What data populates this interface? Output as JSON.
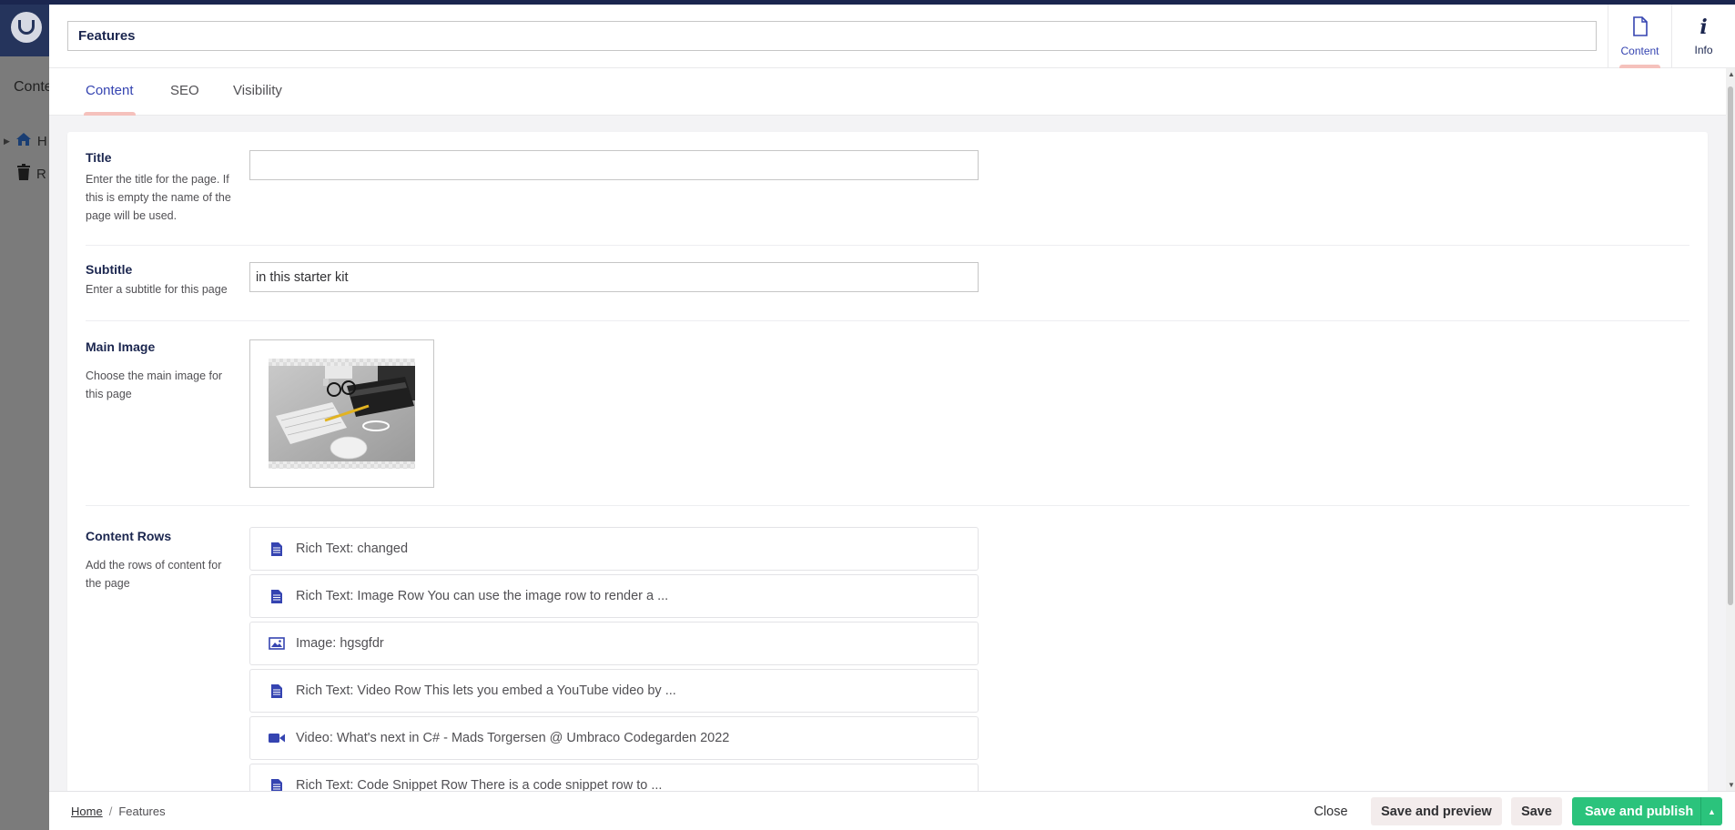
{
  "background": {
    "section_label": "Conte",
    "tree": [
      {
        "icon": "home-icon",
        "label": "H"
      },
      {
        "icon": "trash-icon",
        "label": "R"
      }
    ]
  },
  "header": {
    "node_name": "Features",
    "apps": [
      {
        "label": "Content",
        "icon": "document-icon",
        "active": true
      },
      {
        "label": "Info",
        "icon": "info-icon",
        "active": false
      }
    ]
  },
  "tabs": [
    {
      "label": "Content",
      "active": true
    },
    {
      "label": "SEO",
      "active": false
    },
    {
      "label": "Visibility",
      "active": false
    }
  ],
  "properties": {
    "title": {
      "label": "Title",
      "description": "Enter the title for the page. If this is empty the name of the page will be used.",
      "value": ""
    },
    "subtitle": {
      "label": "Subtitle",
      "description": "Enter a subtitle for this page",
      "value": "in this starter kit"
    },
    "main_image": {
      "label": "Main Image",
      "description": "Choose the main image for this page"
    },
    "content_rows": {
      "label": "Content Rows",
      "description": "Add the rows of content for the page",
      "rows": [
        {
          "icon": "document-icon",
          "label": "Rich Text: changed"
        },
        {
          "icon": "document-icon",
          "label": "Rich Text: Image Row You can use the image row to render a ..."
        },
        {
          "icon": "picture-icon",
          "label": "Image: hgsgfdr"
        },
        {
          "icon": "document-icon",
          "label": "Rich Text: Video Row This lets you embed a YouTube video by ..."
        },
        {
          "icon": "video-icon",
          "label": "Video: What's next in C# - Mads Torgersen @ Umbraco Codegarden 2022"
        },
        {
          "icon": "document-icon",
          "label": "Rich Text: Code Snippet Row There is a code snippet row to ..."
        }
      ]
    }
  },
  "footer": {
    "breadcrumb": {
      "root": "Home",
      "separator": "/",
      "current": "Features"
    },
    "close_label": "Close",
    "save_preview_label": "Save and preview",
    "save_label": "Save",
    "publish_label": "Save and publish"
  },
  "colors": {
    "accent": "#3544b1",
    "tab_indicator": "#f5c1bc",
    "publish_green": "#2bc37c",
    "navy": "#1b264f"
  }
}
